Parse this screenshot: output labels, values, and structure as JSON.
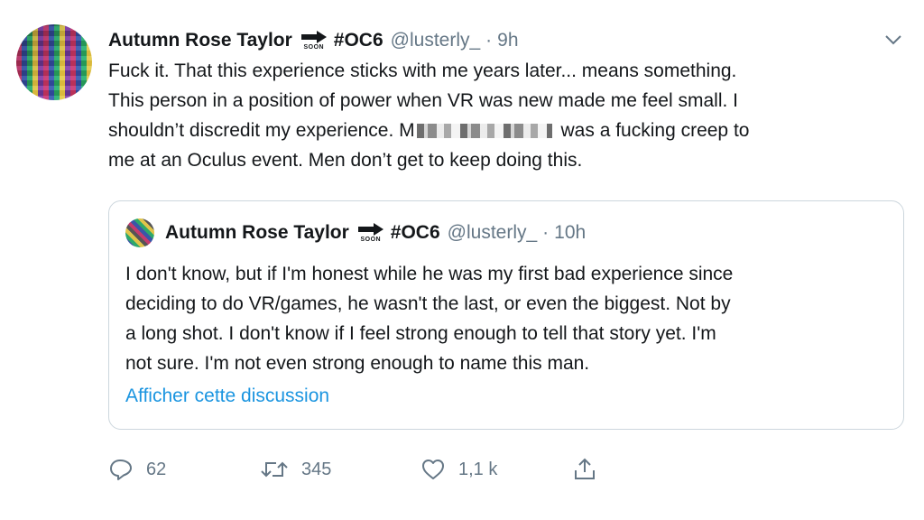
{
  "tweet": {
    "author_name": "Autumn Rose Taylor",
    "soon_label": "SOON",
    "hashtag": "#OC6",
    "handle": "@lusterly_",
    "separator": "·",
    "time": "9h",
    "text_lines": [
      "Fuck it. That this experience sticks with me years later... means something.",
      "This person in a position of power when VR was new made me feel small. I",
      "shouldn’t discredit my experience.",
      "was a fucking creep to",
      "me at an Oculus event. Men don’t get to keep doing this."
    ],
    "redacted_prefix": "M"
  },
  "quoted": {
    "author_name": "Autumn Rose Taylor",
    "soon_label": "SOON",
    "hashtag": "#OC6",
    "handle": "@lusterly_",
    "separator": "·",
    "time": "10h",
    "text_lines": [
      "I don't know, but if I'm honest while he was my first bad experience since",
      "deciding to do VR/games, he wasn't the last, or even the biggest. Not by",
      "a long shot. I don't know if I feel strong enough to tell that story yet. I'm",
      "not sure. I'm not even strong enough to name this man."
    ],
    "show_thread_link": "Afficher cette discussion"
  },
  "actions": {
    "reply_count": "62",
    "retweet_count": "345",
    "like_count": "1,1 k",
    "icons": [
      "reply-icon",
      "retweet-icon",
      "like-icon",
      "share-icon"
    ]
  },
  "colors": {
    "text": "#14171a",
    "secondary": "#657786",
    "link": "#1b95e0",
    "border": "#ccd6dd"
  }
}
